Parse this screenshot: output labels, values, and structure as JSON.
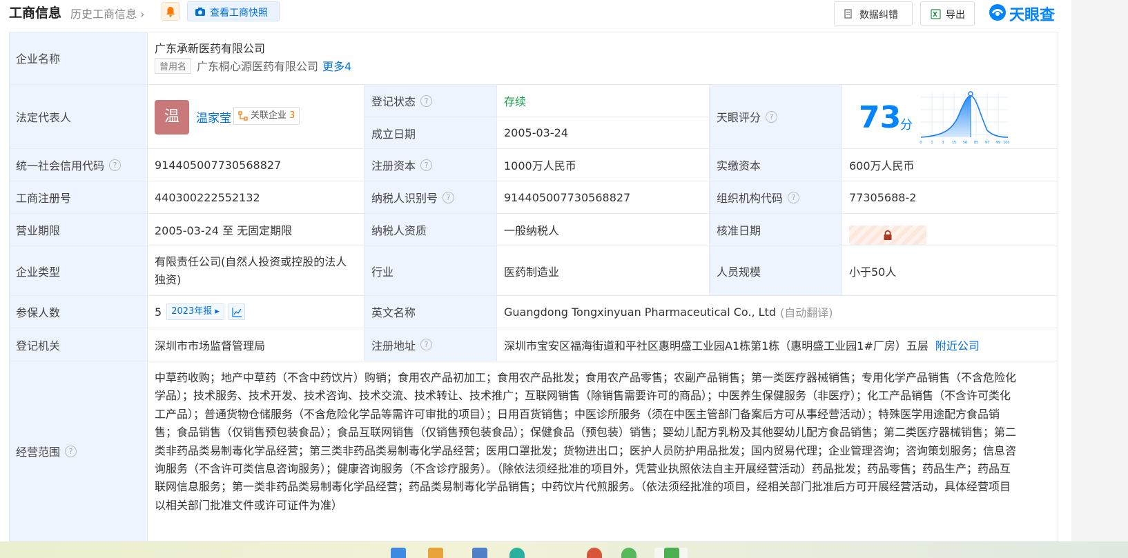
{
  "header": {
    "title": "工商信息",
    "history_label": "历史工商信息",
    "snapshot_label": "查看工商快照",
    "correction_label": "数据纠错",
    "export_label": "导出",
    "brand_name": "天眼查"
  },
  "company": {
    "name_label": "企业名称",
    "name": "广东承新医药有限公司",
    "former_tag": "曾用名",
    "former_name": "广东桐心源医药有限公司",
    "former_more": "更多4",
    "legal_rep_label": "法定代表人",
    "legal_rep_avatar": "温",
    "legal_rep_name": "温家莹",
    "related_label": "关联企业",
    "related_count": "3",
    "reg_status_label": "登记状态",
    "reg_status": "存续",
    "founded_label": "成立日期",
    "founded": "2005-03-24",
    "score_label": "天眼评分",
    "score": "73",
    "score_unit": "分",
    "score_axis_ticks": [
      "0",
      "1",
      "3",
      "15",
      "50",
      "85",
      "97",
      "99",
      "100"
    ],
    "credit_code_label": "统一社会信用代码",
    "credit_code": "914405007730568827",
    "reg_capital_label": "注册资本",
    "reg_capital": "1000万人民币",
    "paid_capital_label": "实缴资本",
    "paid_capital": "600万人民币",
    "biz_reg_no_label": "工商注册号",
    "biz_reg_no": "440300222552132",
    "taxpayer_id_label": "纳税人识别号",
    "taxpayer_id": "914405007730568827",
    "org_code_label": "组织机构代码",
    "org_code": "77305688-2",
    "term_label": "营业期限",
    "term": "2005-03-24 至 无固定期限",
    "taxpayer_type_label": "纳税人资质",
    "taxpayer_type": "一般纳税人",
    "approval_date_label": "核准日期",
    "type_label": "企业类型",
    "type": "有限责任公司(自然人投资或控股的法人独资)",
    "industry_label": "行业",
    "industry": "医药制造业",
    "staff_size_label": "人员规模",
    "staff_size": "小于50人",
    "insured_label": "参保人数",
    "insured": "5",
    "insured_report": "2023年报",
    "english_name_label": "英文名称",
    "english_name": "Guangdong Tongxinyuan Pharmaceutical Co., Ltd",
    "english_note": "(自动翻译)",
    "authority_label": "登记机关",
    "authority": "深圳市市场监督管理局",
    "address_label": "注册地址",
    "address": "深圳市宝安区福海街道和平社区惠明盛工业园A1栋第1栋（惠明盛工业园1#厂房）五层",
    "nearby_label": "附近公司",
    "scope_label": "经营范围",
    "scope": "中草药收购；地产中草药（不含中药饮片）购销；食用农产品初加工；食用农产品批发；食用农产品零售；农副产品销售；第一类医疗器械销售；专用化学产品销售（不含危险化学品）；技术服务、技术开发、技术咨询、技术交流、技术转让、技术推广；互联网销售（除销售需要许可的商品）；中医养生保健服务（非医疗）；化工产品销售（不含许可类化工产品）；普通货物仓储服务（不含危险化学品等需许可审批的项目）；日用百货销售；中医诊所服务（须在中医主管部门备案后方可从事经营活动）；特殊医学用途配方食品销售；食品销售（仅销售预包装食品）；食品互联网销售（仅销售预包装食品）；保健食品（预包装）销售；婴幼儿配方乳粉及其他婴幼儿配方食品销售；第二类医疗器械销售；第二类非药品类易制毒化学品经营；第三类非药品类易制毒化学品经营；医用口罩批发；货物进出口；医护人员防护用品批发；国内贸易代理；企业管理咨询；咨询策划服务；信息咨询服务（不含许可类信息咨询服务）；健康咨询服务（不含诊疗服务）。（除依法须经批准的项目外，凭营业执照依法自主开展经营活动）药品批发；药品零售；药品生产；药品互联网信息服务；第一类非药品类易制毒化学品经营；药品类易制毒化学品销售；中药饮片代煎服务。（依法须经批准的项目，经相关部门批准后方可开展经营活动，具体经营项目以相关部门批准文件或许可证件为准）"
  },
  "colors": {
    "accent": "#0084ff",
    "label_bg": "#eef4fd",
    "status_green": "#1aa34a",
    "avatar": "#c9787a"
  }
}
